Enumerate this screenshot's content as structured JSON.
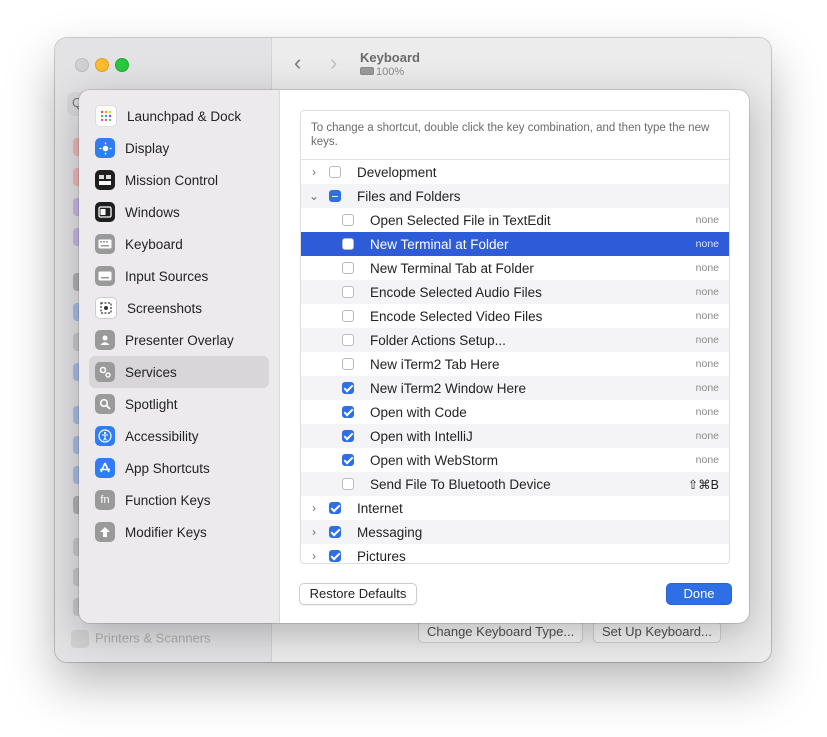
{
  "window": {
    "title": "Keyboard",
    "subtitle": "100%",
    "search_placeholder": "Q",
    "footer_buttons": [
      "Change Keyboard Type...",
      "Set Up Keyboard..."
    ],
    "help_label": "?",
    "bg_sidebar_last": "Printers & Scanners"
  },
  "sidebar": {
    "items": [
      {
        "label": "Launchpad & Dock",
        "icon": "launchpad-icon",
        "color": "#ffffff"
      },
      {
        "label": "Display",
        "icon": "display-icon",
        "color": "#2f7df6"
      },
      {
        "label": "Mission Control",
        "icon": "mission-control-icon",
        "color": "#1f1f1f"
      },
      {
        "label": "Windows",
        "icon": "windows-icon",
        "color": "#1f1f1f"
      },
      {
        "label": "Keyboard",
        "icon": "keyboard-icon",
        "color": "#9a9a9a"
      },
      {
        "label": "Input Sources",
        "icon": "input-sources-icon",
        "color": "#9a9a9a"
      },
      {
        "label": "Screenshots",
        "icon": "screenshots-icon",
        "color": "#ffffff"
      },
      {
        "label": "Presenter Overlay",
        "icon": "presenter-overlay-icon",
        "color": "#9a9a9a"
      },
      {
        "label": "Services",
        "icon": "services-icon",
        "color": "#9a9a9a",
        "selected": true
      },
      {
        "label": "Spotlight",
        "icon": "spotlight-icon",
        "color": "#9a9a9a"
      },
      {
        "label": "Accessibility",
        "icon": "accessibility-icon",
        "color": "#2f7df6"
      },
      {
        "label": "App Shortcuts",
        "icon": "app-shortcuts-icon",
        "color": "#2f7df6"
      },
      {
        "label": "Function Keys",
        "icon": "function-keys-icon",
        "color": "#9a9a9a",
        "glyph": "fn"
      },
      {
        "label": "Modifier Keys",
        "icon": "modifier-keys-icon",
        "color": "#9a9a9a"
      }
    ]
  },
  "content": {
    "hint": "To change a shortcut, double click the key combination, and then type the new keys.",
    "rows": [
      {
        "type": "group",
        "label": "Development",
        "disclosure": "›",
        "checked": "off"
      },
      {
        "type": "group",
        "label": "Files and Folders",
        "disclosure": "⌄",
        "checked": "mixed"
      },
      {
        "type": "item",
        "label": "Open Selected File in TextEdit",
        "shortcut": "none",
        "checked": "off"
      },
      {
        "type": "item",
        "label": "New Terminal at Folder",
        "shortcut": "none",
        "checked": "off",
        "selected": true
      },
      {
        "type": "item",
        "label": "New Terminal Tab at Folder",
        "shortcut": "none",
        "checked": "off"
      },
      {
        "type": "item",
        "label": "Encode Selected Audio Files",
        "shortcut": "none",
        "checked": "off"
      },
      {
        "type": "item",
        "label": "Encode Selected Video Files",
        "shortcut": "none",
        "checked": "off"
      },
      {
        "type": "item",
        "label": "Folder Actions Setup...",
        "shortcut": "none",
        "checked": "off"
      },
      {
        "type": "item",
        "label": "New iTerm2 Tab Here",
        "shortcut": "none",
        "checked": "off"
      },
      {
        "type": "item",
        "label": "New iTerm2 Window Here",
        "shortcut": "none",
        "checked": "on"
      },
      {
        "type": "item",
        "label": "Open with Code",
        "shortcut": "none",
        "checked": "on"
      },
      {
        "type": "item",
        "label": "Open with IntelliJ",
        "shortcut": "none",
        "checked": "on"
      },
      {
        "type": "item",
        "label": "Open with WebStorm",
        "shortcut": "none",
        "checked": "on"
      },
      {
        "type": "item",
        "label": "Send File To Bluetooth Device",
        "shortcut": "⇧⌘B",
        "checked": "off"
      },
      {
        "type": "group",
        "label": "Internet",
        "disclosure": "›",
        "checked": "on"
      },
      {
        "type": "group",
        "label": "Messaging",
        "disclosure": "›",
        "checked": "on"
      },
      {
        "type": "group",
        "label": "Pictures",
        "disclosure": "›",
        "checked": "on"
      }
    ]
  },
  "buttons": {
    "restore": "Restore Defaults",
    "done": "Done"
  },
  "colors": {
    "accent": "#2f6fe5",
    "selection": "#2e5bd8"
  }
}
